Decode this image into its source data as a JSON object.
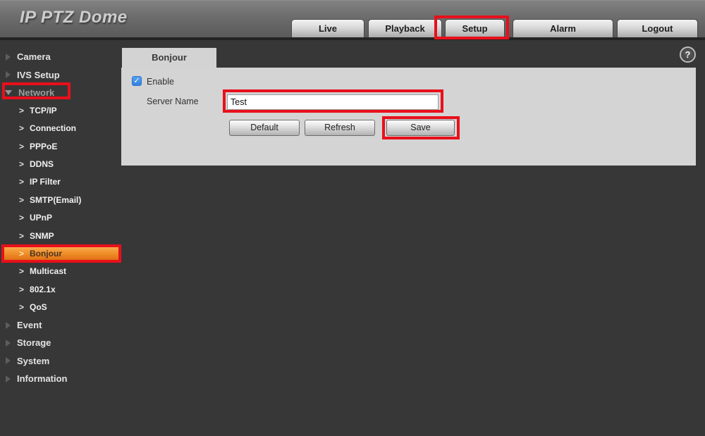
{
  "header": {
    "title": "IP PTZ Dome",
    "tabs": [
      {
        "label": "Live"
      },
      {
        "label": "Playback"
      },
      {
        "label": "Setup",
        "active": true
      },
      {
        "label": "Alarm"
      },
      {
        "label": "Logout"
      }
    ]
  },
  "sidebar": {
    "items": [
      {
        "label": "Camera",
        "type": "section",
        "expanded": false
      },
      {
        "label": "IVS Setup",
        "type": "section",
        "expanded": false
      },
      {
        "label": "Network",
        "type": "section",
        "expanded": true
      },
      {
        "label": "TCP/IP",
        "type": "sub"
      },
      {
        "label": "Connection",
        "type": "sub"
      },
      {
        "label": "PPPoE",
        "type": "sub"
      },
      {
        "label": "DDNS",
        "type": "sub"
      },
      {
        "label": "IP Filter",
        "type": "sub"
      },
      {
        "label": "SMTP(Email)",
        "type": "sub"
      },
      {
        "label": "UPnP",
        "type": "sub"
      },
      {
        "label": "SNMP",
        "type": "sub"
      },
      {
        "label": "Bonjour",
        "type": "sub",
        "selected": true
      },
      {
        "label": "Multicast",
        "type": "sub"
      },
      {
        "label": "802.1x",
        "type": "sub"
      },
      {
        "label": "QoS",
        "type": "sub"
      },
      {
        "label": "Event",
        "type": "section",
        "expanded": false
      },
      {
        "label": "Storage",
        "type": "section",
        "expanded": false
      },
      {
        "label": "System",
        "type": "section",
        "expanded": false
      },
      {
        "label": "Information",
        "type": "section",
        "expanded": false
      }
    ]
  },
  "content": {
    "tab_label": "Bonjour",
    "enable_label": "Enable",
    "enable_checked": true,
    "server_name_label": "Server Name",
    "server_name_value": "Test",
    "buttons": {
      "default_label": "Default",
      "refresh_label": "Refresh",
      "save_label": "Save"
    }
  },
  "icons": {
    "help": "?",
    "check": "✓",
    "chevron": ">"
  },
  "colors": {
    "annotation_red": "#e8101b",
    "selected_orange": "#ef8c28",
    "checkbox_blue": "#3381dd",
    "panel_gray": "#d4d4d4",
    "page_dark": "#373737"
  }
}
